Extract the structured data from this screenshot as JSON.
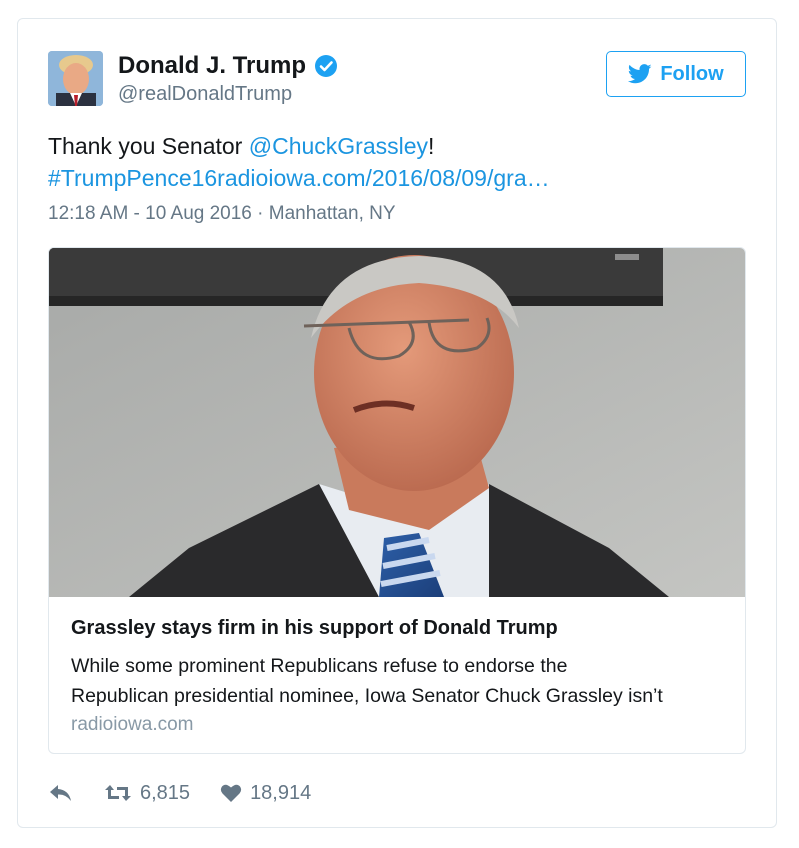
{
  "author": {
    "name": "Donald J. Trump",
    "handle": "@realDonaldTrump",
    "verified": true
  },
  "follow_button": {
    "label": "Follow",
    "icon": "twitter-bird-icon"
  },
  "tweet": {
    "text_prefix": "Thank you Senator ",
    "mention": "@ChuckGrassley",
    "text_suffix": "!",
    "hashtag_link": "#TrumpPence16radioiowa.com/2016/08/09/gra…",
    "timestamp": "12:18 AM - 10 Aug 2016",
    "separator": " · ",
    "location": "Manhattan, NY"
  },
  "card": {
    "title": "Grassley stays firm in his support of Donald Trump",
    "description_line1": "While some prominent Republicans refuse to endorse the",
    "description_line2": "Republican presidential nominee, Iowa Senator Chuck Grassley isn’t",
    "domain": "radioiowa.com"
  },
  "actions": {
    "reply_icon": "reply-icon",
    "retweet_icon": "retweet-icon",
    "retweet_count": "6,815",
    "like_icon": "heart-icon",
    "like_count": "18,914"
  },
  "colors": {
    "accent": "#1da1f2",
    "link": "#1b95e0",
    "text": "#14171a",
    "muted": "#657786",
    "border": "#e1e8ed"
  }
}
